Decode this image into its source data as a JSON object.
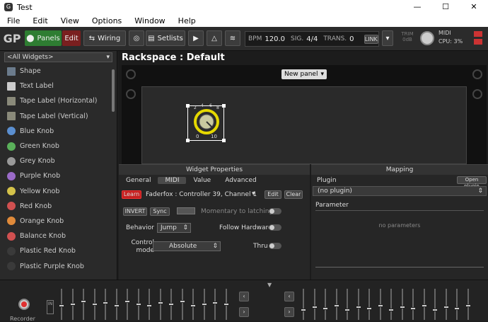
{
  "window": {
    "title": "Test",
    "minimize": "—",
    "maximize": "☐",
    "close": "✕"
  },
  "menu": [
    "File",
    "Edit",
    "View",
    "Options",
    "Window",
    "Help"
  ],
  "toolbar": {
    "panels_label": "Panels",
    "edit_label": "Edit",
    "wiring_label": "Wiring",
    "setlists_label": "Setlists",
    "bpm_label": "BPM",
    "bpm_value": "120.0",
    "sig_label": "SIG.",
    "sig_value": "4/4",
    "trans_label": "TRANS.",
    "trans_value": "0",
    "link_label": "LINK",
    "trim_label": "TRIM",
    "trim_value": "0dB",
    "midi_label": "MIDI",
    "cpu_label": "CPU:",
    "cpu_value": "3%"
  },
  "sidebar": {
    "filter": "<All Widgets>",
    "items": [
      {
        "label": "Shape",
        "icon": "shape-icon",
        "color": "#6b7b8c"
      },
      {
        "label": "Text Label",
        "icon": "text-label-icon",
        "color": "#cccccc"
      },
      {
        "label": "Tape Label (Horizontal)",
        "icon": "tape-label-icon",
        "color": "#8a8a7a"
      },
      {
        "label": "Tape Label (Vertical)",
        "icon": "tape-label-vertical-icon",
        "color": "#8a8a7a"
      },
      {
        "label": "Blue Knob",
        "icon": "blue-knob-icon",
        "color": "#5b8fd0"
      },
      {
        "label": "Green Knob",
        "icon": "green-knob-icon",
        "color": "#5ab05a"
      },
      {
        "label": "Grey Knob",
        "icon": "grey-knob-icon",
        "color": "#9a9a9a"
      },
      {
        "label": "Purple Knob",
        "icon": "purple-knob-icon",
        "color": "#9a6bc8"
      },
      {
        "label": "Yellow Knob",
        "icon": "yellow-knob-icon",
        "color": "#d4c24a"
      },
      {
        "label": "Red Knob",
        "icon": "red-knob-icon",
        "color": "#d05050"
      },
      {
        "label": "Orange Knob",
        "icon": "orange-knob-icon",
        "color": "#e08a3a"
      },
      {
        "label": "Balance Knob",
        "icon": "balance-knob-icon",
        "color": "#d05050"
      },
      {
        "label": "Plastic Red Knob",
        "icon": "plastic-red-knob-icon",
        "color": "#3a3a3a"
      },
      {
        "label": "Plastic Purple Knob",
        "icon": "plastic-purple-knob-icon",
        "color": "#3a3a3a"
      }
    ]
  },
  "rackspace": {
    "title": "Rackspace : Default",
    "panel_button": "New panel"
  },
  "knob": {
    "scale_min": "0",
    "scale_max": "10",
    "tick_labels": [
      "2",
      "4",
      "6",
      "8"
    ]
  },
  "widget_properties": {
    "header": "Widget Properties",
    "tabs": [
      "General",
      "MIDI",
      "Value",
      "Advanced"
    ],
    "active_tab": "MIDI",
    "learn_label": "Learn",
    "midi_source": "Faderfox : Controller 39, Channel 1",
    "edit_label": "Edit",
    "clear_label": "Clear",
    "invert_label": "INVERT",
    "sync_label": "Sync",
    "momentary_label": "Momentary to latching",
    "behavior_label": "Behavior",
    "behavior_value": "Jump",
    "follow_label": "Follow Hardware",
    "control_mode_label": "Control mode",
    "control_mode_value": "Absolute",
    "thru_label": "Thru"
  },
  "mapping": {
    "header": "Mapping",
    "plugin_label": "Plugin",
    "open_plugin_label": "Open plugin",
    "plugin_value": "(no plugin)",
    "parameter_label": "Parameter",
    "empty_text": "no parameters"
  },
  "bottom": {
    "record_label": "Recorder",
    "left_faders": [
      0.45,
      0.5,
      0.6,
      0.5,
      0.55,
      0.45,
      0.6,
      0.5,
      0.45,
      0.55,
      0.5,
      0.6,
      0.45,
      0.5,
      0.55,
      0.5
    ],
    "right_faders": [
      0.3,
      0.4,
      0.35,
      0.45,
      0.3,
      0.4,
      0.35,
      0.45,
      0.3,
      0.4,
      0.35,
      0.45,
      0.3,
      0.4,
      0.35,
      0.45
    ]
  }
}
